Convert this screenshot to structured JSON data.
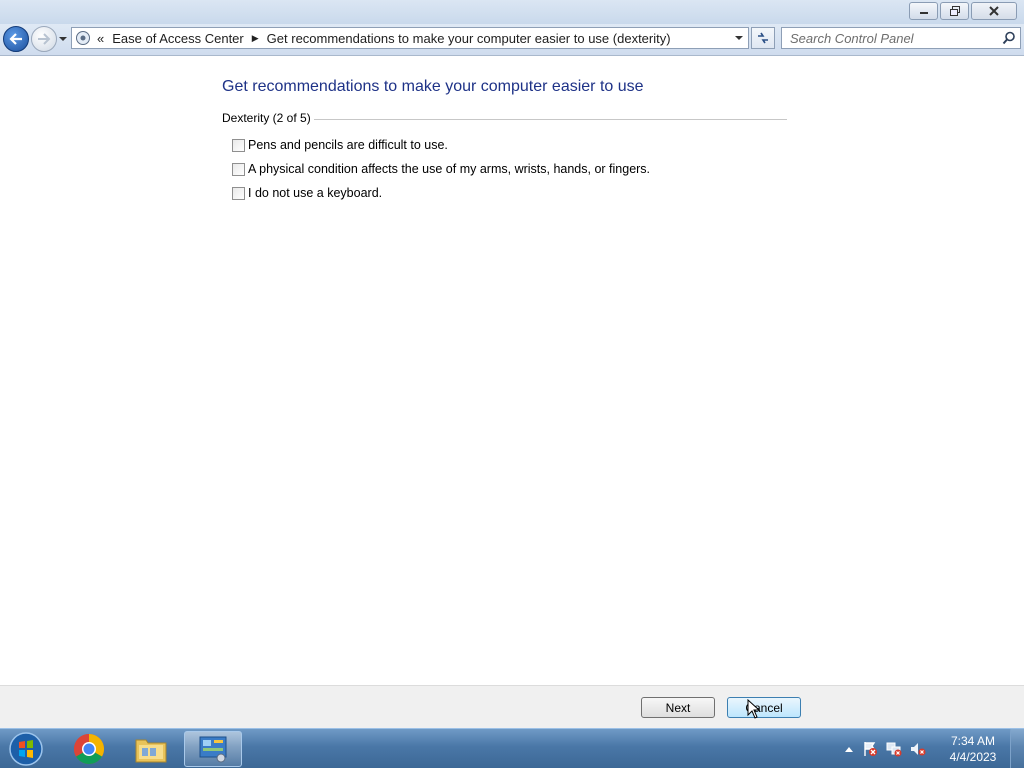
{
  "window": {
    "buttons": [
      "minimize-icon",
      "restore-icon",
      "close-icon"
    ]
  },
  "address_bar": {
    "overflow_chevron": "«",
    "segments": [
      "Ease of Access Center",
      "Get recommendations to make your computer easier to use (dexterity)"
    ]
  },
  "search": {
    "placeholder": "Search Control Panel"
  },
  "main": {
    "heading": "Get recommendations to make your computer easier to use",
    "group_label": "Dexterity (2 of 5)",
    "options": [
      {
        "label": "Pens and pencils are difficult to use.",
        "checked": false
      },
      {
        "label": "A physical condition affects the use of my arms, wrists, hands, or fingers.",
        "checked": false
      },
      {
        "label": "I do not use a keyboard.",
        "checked": false
      }
    ]
  },
  "buttons": {
    "next": "Next",
    "cancel": "Cancel"
  },
  "taskbar": {
    "items": [
      "start-orb-icon",
      "chrome-icon",
      "file-explorer-icon",
      "control-panel-icon"
    ],
    "tray_icons": [
      "show-hidden-icons",
      "action-center-icon",
      "network-icon",
      "volume-muted-icon"
    ],
    "time": "7:34 AM",
    "date": "4/4/2023"
  }
}
